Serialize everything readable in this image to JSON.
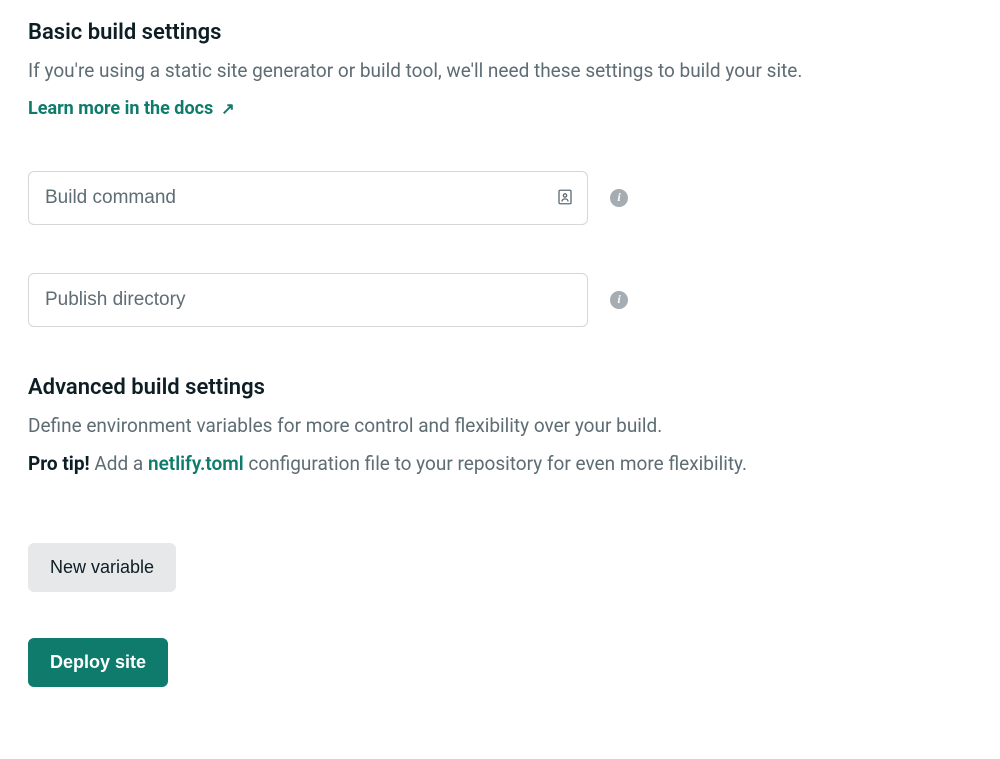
{
  "basic": {
    "title": "Basic build settings",
    "description": "If you're using a static site generator or build tool, we'll need these settings to build your site.",
    "docs_link": "Learn more in the docs",
    "build_command": {
      "placeholder": "Build command",
      "value": ""
    },
    "publish_directory": {
      "placeholder": "Publish directory",
      "value": ""
    }
  },
  "advanced": {
    "title": "Advanced build settings",
    "description": "Define environment variables for more control and flexibility over your build.",
    "pro_tip_label": "Pro tip!",
    "pro_tip_prefix": " Add a ",
    "pro_tip_link": "netlify.toml",
    "pro_tip_suffix": " configuration file to your repository for even more flexibility.",
    "new_variable_label": "New variable"
  },
  "deploy_label": "Deploy site",
  "info_glyph": "i",
  "colors": {
    "accent": "#0e7b6c",
    "muted": "#5e6c74",
    "btn_secondary": "#e6e8ea"
  }
}
